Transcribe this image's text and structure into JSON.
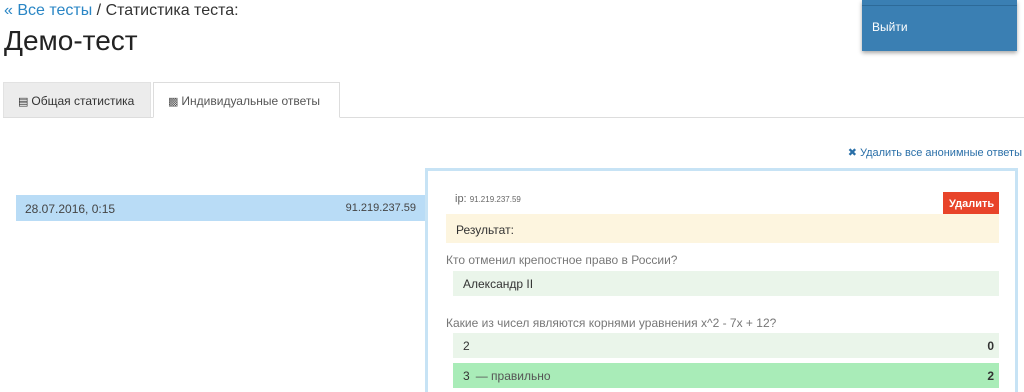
{
  "breadcrumb": {
    "back_link": "« Все тесты",
    "separator": " / ",
    "current": "Статистика теста:"
  },
  "page": {
    "title": "Демо-тест"
  },
  "user_menu": {
    "logout_label": "Выйти",
    "color": "#3a7fb3"
  },
  "tabs": [
    {
      "label": "Общая статистика",
      "icon": "list-icon",
      "active": false
    },
    {
      "label": "Индивидуальные ответы",
      "icon": "sitemap-icon",
      "active": true
    }
  ],
  "actions": {
    "delete_anonymous_label": "Удалить все анонимные ответы"
  },
  "answers_list": [
    {
      "date": "28.07.2016, 0:15",
      "ip": "91.219.237.59",
      "selected": true
    }
  ],
  "detail": {
    "ip_label": "ip:",
    "ip_value": "91.219.237.59",
    "delete_label": "Удалить",
    "result_label": "Результат:",
    "questions": [
      {
        "text": "Кто отменил крепостное право в России?",
        "answers": [
          {
            "text": "Александр II",
            "note": "",
            "score": "",
            "correct": false
          }
        ]
      },
      {
        "text": "Какие из чисел являются корнями уравнения x^2 - 7x + 12?",
        "answers": [
          {
            "text": "2",
            "note": "",
            "score": "0",
            "correct": false
          },
          {
            "text": "3",
            "note": "— правильно",
            "score": "2",
            "correct": true
          }
        ]
      }
    ]
  },
  "colors": {
    "link": "#2a86c5",
    "selected_row": "#b9dcf6",
    "delete_button": "#e8442a",
    "result_bg": "#fdf5df",
    "correct_bg": "#a9ecb8",
    "answer_bg": "#eaf5ea"
  }
}
